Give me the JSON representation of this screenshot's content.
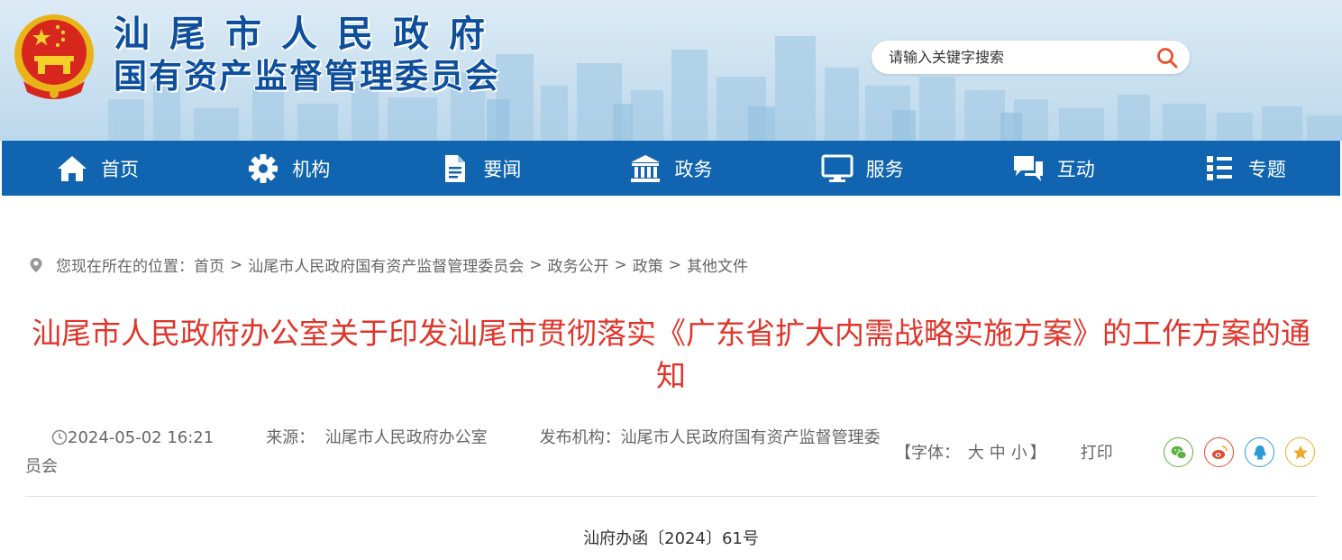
{
  "header": {
    "title_line1": "汕尾市人民政府",
    "title_line2": "国有资产监督管理委员会",
    "search_placeholder": "请输入关键字搜索"
  },
  "nav": [
    {
      "label": "首页",
      "icon": "home-icon"
    },
    {
      "label": "机构",
      "icon": "gear-icon"
    },
    {
      "label": "要闻",
      "icon": "document-icon"
    },
    {
      "label": "政务",
      "icon": "government-building-icon"
    },
    {
      "label": "服务",
      "icon": "monitor-icon"
    },
    {
      "label": "互动",
      "icon": "chat-bubbles-icon"
    },
    {
      "label": "专题",
      "icon": "list-icon"
    }
  ],
  "breadcrumb": {
    "prefix": "您现在所在的位置：",
    "items": [
      "首页",
      "汕尾市人民政府国有资产监督管理委员会",
      "政务公开",
      "政策",
      "其他文件"
    ],
    "separator": ">"
  },
  "article": {
    "title": "汕尾市人民政府办公室关于印发汕尾市贯彻落实《广东省扩大内需战略实施方案》的工作方案的通知",
    "date": "2024-05-02 16:21",
    "source_label": "来源：",
    "source": "汕尾市人民政府办公室",
    "publisher_label": "发布机构：",
    "publisher": "汕尾市人民政府国有资产监督管理委员会",
    "doc_number": "汕府办函〔2024〕61号"
  },
  "tools": {
    "font_label": "【字体：",
    "font_large": "大",
    "font_medium": "中",
    "font_small": "小",
    "font_close": "】",
    "print": "打印"
  },
  "share": [
    {
      "name": "wechat-share-icon",
      "color": "#5bb343"
    },
    {
      "name": "weibo-share-icon",
      "color": "#e5492d"
    },
    {
      "name": "qq-share-icon",
      "color": "#2e9bd6"
    },
    {
      "name": "favorite-star-icon",
      "color": "#f0a828"
    }
  ]
}
